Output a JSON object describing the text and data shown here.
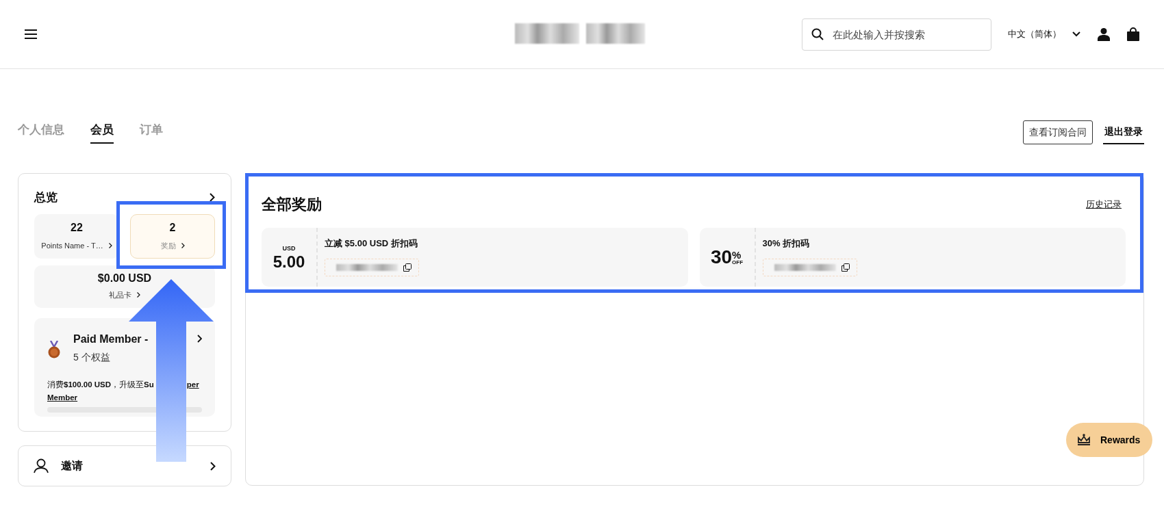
{
  "header": {
    "search": {
      "placeholder": "在此处输入并按搜索"
    },
    "language": "中文（简体）"
  },
  "tabs": [
    {
      "label": "个人信息",
      "selected": false
    },
    {
      "label": "会员",
      "selected": true
    },
    {
      "label": "订单",
      "selected": false
    }
  ],
  "actions": {
    "contract_button": "查看订阅合同",
    "logout_link": "退出登录"
  },
  "overview": {
    "title": "总览",
    "stats": [
      {
        "value": "22",
        "label": "Points Name - T…",
        "selected": false
      },
      {
        "value": "2",
        "label": "奖励",
        "selected": true
      }
    ],
    "gift_card": {
      "value": "$0.00 USD",
      "label": "礼品卡"
    },
    "membership": {
      "tier": "Paid Member -",
      "benefits": "5 个权益",
      "upgrade_start": "消费**$100.00 USD**，升级至**Su**",
      "upgrade_tail": "per",
      "upgrade_line2": "Member",
      "level": 0
    }
  },
  "invite": {
    "label": "邀请"
  },
  "rewards": {
    "title": "全部奖励",
    "history_link": "历史记录",
    "coupons": [
      {
        "kind": "amount",
        "unit": "USD",
        "amount": "5.00",
        "name": "立减 $5.00 USD 折扣码"
      },
      {
        "kind": "percent",
        "amount": "30",
        "unit": "%",
        "suffix": "OFF",
        "name": "30% 折扣码"
      }
    ]
  },
  "floating_button": {
    "label": "Rewards"
  }
}
